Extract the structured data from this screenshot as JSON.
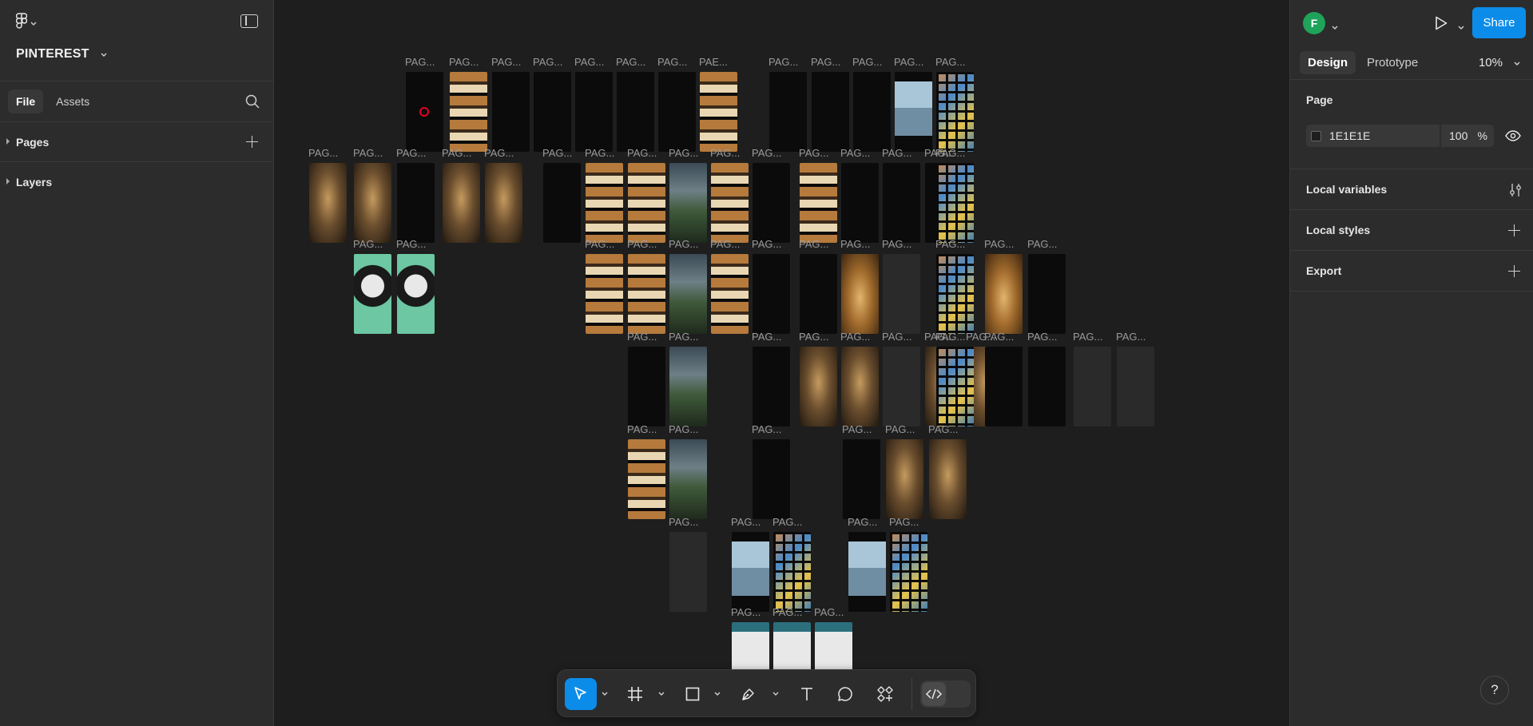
{
  "app": {
    "project_name": "PINTEREST"
  },
  "left_panel": {
    "tabs": [
      {
        "label": "File",
        "active": true
      },
      {
        "label": "Assets",
        "active": false
      }
    ],
    "sections": [
      {
        "label": "Pages"
      },
      {
        "label": "Layers"
      }
    ]
  },
  "right_panel": {
    "avatar_letter": "F",
    "share_label": "Share",
    "tabs": [
      {
        "label": "Design",
        "active": true
      },
      {
        "label": "Prototype",
        "active": false
      }
    ],
    "zoom": "10%",
    "page": {
      "title": "Page",
      "background_hex": "1E1E1E",
      "opacity": "100",
      "opacity_unit": "%"
    },
    "rows": [
      {
        "label": "Local variables"
      },
      {
        "label": "Local styles"
      },
      {
        "label": "Export"
      }
    ],
    "help_label": "?"
  },
  "canvas": {
    "frame_label": "PAG...",
    "frame_label_alt": "PAE..."
  },
  "toolbar": {
    "tools": [
      "move",
      "frame",
      "rectangle",
      "pen",
      "text",
      "comment",
      "actions"
    ],
    "active_tool": "move"
  }
}
